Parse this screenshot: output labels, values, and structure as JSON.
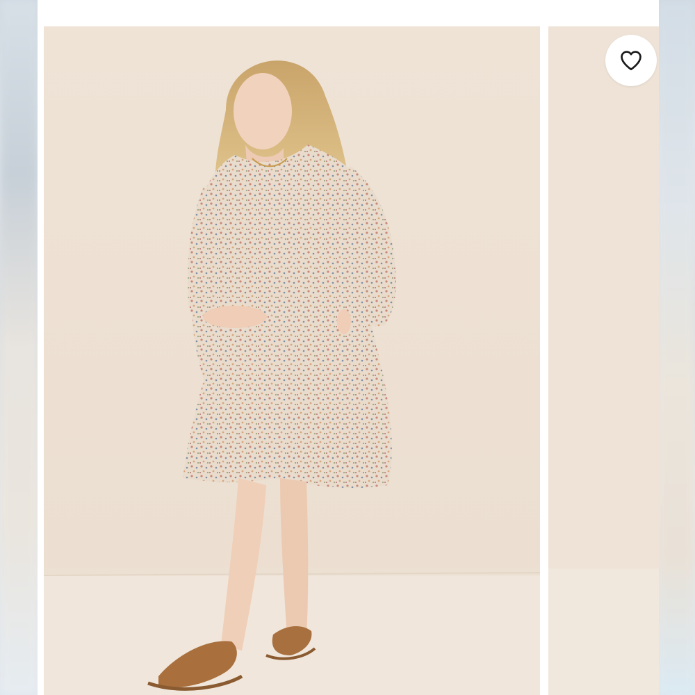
{
  "listing": {
    "images": [
      {
        "icon": "product-photo-floral-maternity-dress"
      },
      {
        "icon": "product-photo-next"
      }
    ],
    "favorite": {
      "icon": "heart-outline-icon",
      "active": false
    }
  },
  "colors": {
    "backdrop": "#efe4d8",
    "page": "#ffffff",
    "icon": "#1a1a1a"
  }
}
